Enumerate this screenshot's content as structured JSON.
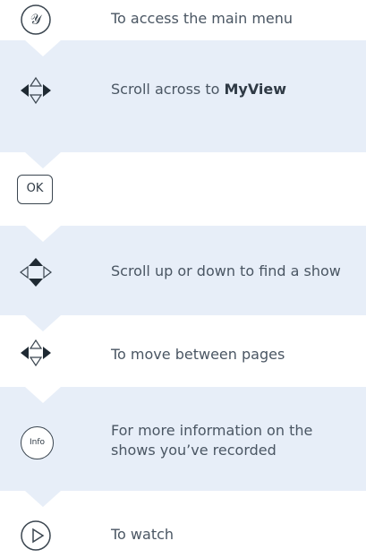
{
  "steps": [
    {
      "icon": "menu-y-icon",
      "text": "To access the main menu"
    },
    {
      "icon": "dpad-left-right-active-icon",
      "text_prefix": "Scroll across to ",
      "text_bold": "MyView"
    },
    {
      "icon": "ok-button-icon",
      "label": "OK"
    },
    {
      "icon": "dpad-up-down-active-icon",
      "text": "Scroll up or down to find a show"
    },
    {
      "icon": "dpad-left-right-active-icon",
      "text": "To move between pages"
    },
    {
      "icon": "info-button-icon",
      "label": "Info",
      "text": "For more information on the shows you’ve recorded"
    },
    {
      "icon": "play-button-icon",
      "text": "To watch"
    }
  ],
  "colors": {
    "band_blue": "#e7eef8",
    "text": "#4a5663",
    "icon_stroke": "#3b4650"
  }
}
